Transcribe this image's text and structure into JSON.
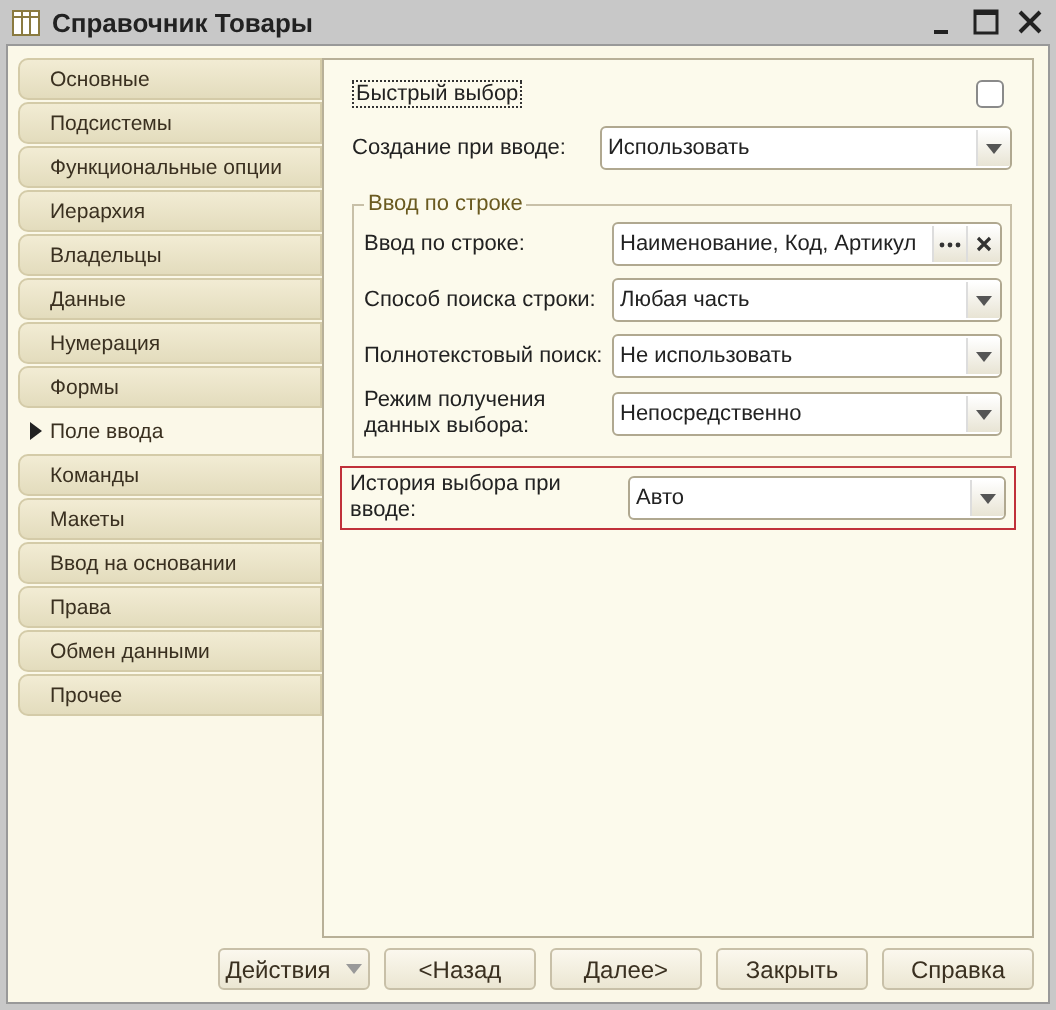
{
  "window": {
    "title": "Справочник Товары"
  },
  "tabs": [
    {
      "label": "Основные",
      "selected": false
    },
    {
      "label": "Подсистемы",
      "selected": false
    },
    {
      "label": "Функциональные опции",
      "selected": false
    },
    {
      "label": "Иерархия",
      "selected": false
    },
    {
      "label": "Владельцы",
      "selected": false
    },
    {
      "label": "Данные",
      "selected": false
    },
    {
      "label": "Нумерация",
      "selected": false
    },
    {
      "label": "Формы",
      "selected": false
    },
    {
      "label": "Поле ввода",
      "selected": true
    },
    {
      "label": "Команды",
      "selected": false
    },
    {
      "label": "Макеты",
      "selected": false
    },
    {
      "label": "Ввод на основании",
      "selected": false
    },
    {
      "label": "Права",
      "selected": false
    },
    {
      "label": "Обмен данными",
      "selected": false
    },
    {
      "label": "Прочее",
      "selected": false
    }
  ],
  "quick_select": {
    "label": "Быстрый выбор",
    "checked": false
  },
  "create_on_input": {
    "label": "Создание при вводе:",
    "value": "Использовать",
    "kind": "select"
  },
  "group": {
    "title": "Ввод по строке",
    "fields": [
      {
        "label": "Ввод по строке:",
        "value": "Наименование, Код, Артикул",
        "kind": "list"
      },
      {
        "label": "Способ поиска строки:",
        "value": "Любая часть",
        "kind": "select"
      },
      {
        "label": "Полнотекстовый поиск:",
        "value": "Не использовать",
        "kind": "select"
      },
      {
        "label": "Режим получения данных выбора:",
        "value": "Непосредственно",
        "kind": "select"
      }
    ]
  },
  "history": {
    "label": "История выбора при вводе:",
    "value": "Авто",
    "kind": "select",
    "highlighted": true
  },
  "buttons": [
    {
      "label": "Действия",
      "kind": "menu"
    },
    {
      "label": "<Назад",
      "kind": "plain"
    },
    {
      "label": "Далее>",
      "kind": "plain"
    },
    {
      "label": "Закрыть",
      "kind": "plain"
    },
    {
      "label": "Справка",
      "kind": "plain"
    }
  ]
}
